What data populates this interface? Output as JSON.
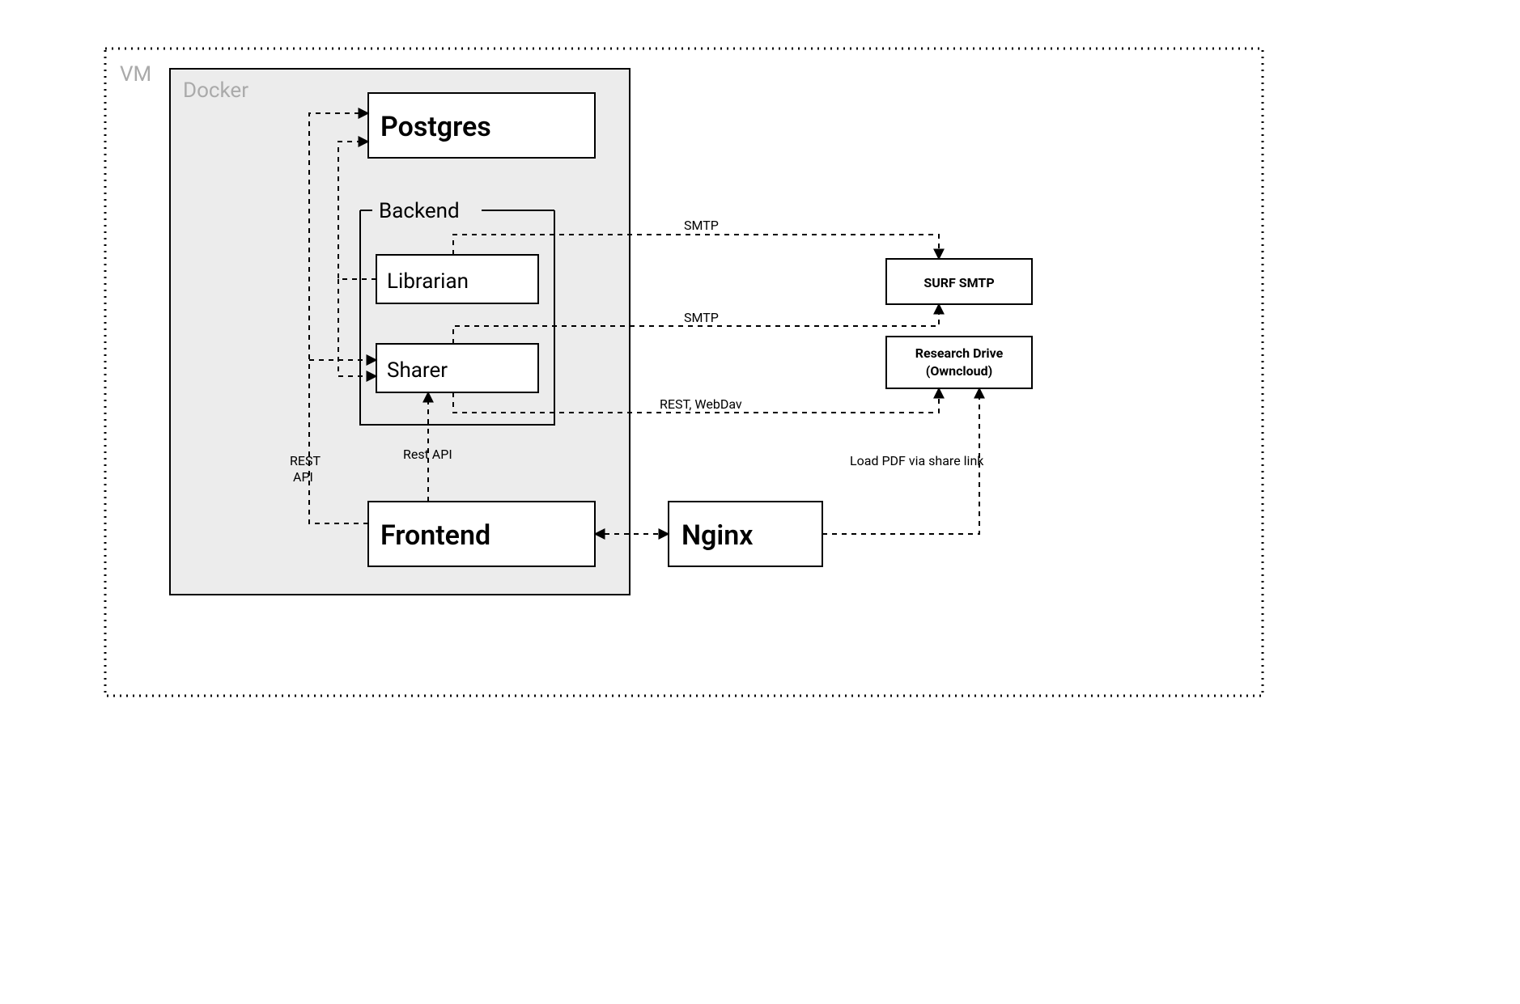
{
  "containers": {
    "vm": {
      "title": "VM"
    },
    "docker": {
      "title": "Docker"
    },
    "backend": {
      "title": "Backend"
    }
  },
  "nodes": {
    "postgres": {
      "label": "Postgres"
    },
    "librarian": {
      "label": "Librarian"
    },
    "sharer": {
      "label": "Sharer"
    },
    "frontend": {
      "label": "Frontend"
    },
    "nginx": {
      "label": "Nginx"
    },
    "smtp": {
      "label": "SURF SMTP"
    },
    "research_drive": {
      "line1": "Research Drive",
      "line2": "(Owncloud)"
    }
  },
  "edges": {
    "rest_api": {
      "line1": "REST",
      "line2": "API"
    },
    "rest_api2": "Rest API",
    "smtp1": "SMTP",
    "smtp2": "SMTP",
    "rest_webdav": "REST, WebDav",
    "load_pdf": "Load PDF via share link"
  }
}
